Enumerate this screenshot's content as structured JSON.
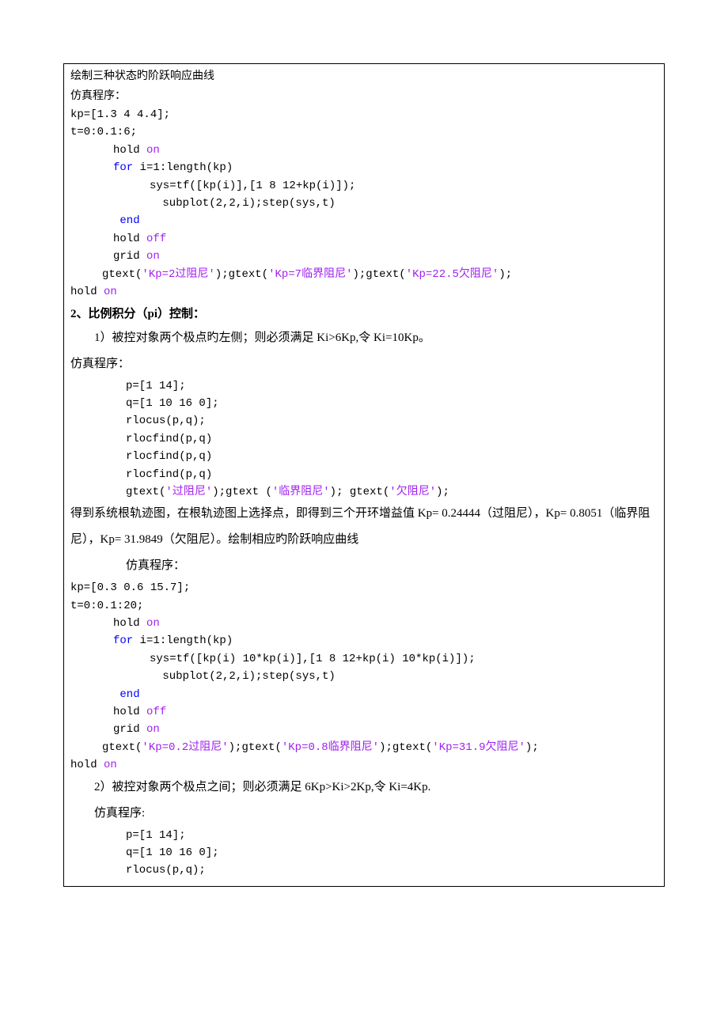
{
  "block1": {
    "title": "绘制三种状态旳阶跃响应曲线",
    "subtitle": "仿真程序：",
    "l1": "kp=[1.3 4 4.4];",
    "l2": "t=0:0.1:6;",
    "l3a": "hold ",
    "l3b": "on",
    "l4a": "for",
    "l4b": " i=1:length(kp)",
    "l5": "sys=tf([kp(i)],[1 8 12+kp(i)]);",
    "l6": " subplot(2,2,i);step(sys,t)",
    "l7": "end",
    "l8a": "hold ",
    "l8b": "off",
    "l9a": "grid ",
    "l9b": "on",
    "l10a": "gtext(",
    "l10b": "'Kp=2过阻尼'",
    "l10c": ");gtext(",
    "l10d": "'Kp=7临界阻尼'",
    "l10e": ");gtext(",
    "l10f": "'Kp=22.5欠阻尼'",
    "l10g": ");",
    "l11a": "hold ",
    "l11b": "on"
  },
  "section2": {
    "heading": "2、比例积分（pi）控制：",
    "p1": "1）被控对象两个极点旳左侧；则必须满足 Ki>6Kp,令 Ki=10Kp。",
    "subtitle": "仿真程序：",
    "c1": "p=[1 14];",
    "c2": "q=[1 10 16 0];",
    "c3": "rlocus(p,q);",
    "c4": "rlocfind(p,q)",
    "c5": "rlocfind(p,q)",
    "c6": "rlocfind(p,q)",
    "c7a": "gtext(",
    "c7b": "'过阻尼'",
    "c7c": ");gtext (",
    "c7d": "'临界阻尼'",
    "c7e": "); gtext(",
    "c7f": "'欠阻尼'",
    "c7g": ");",
    "p2": "得到系统根轨迹图，在根轨迹图上选择点，即得到三个开环增益值 Kp= 0.24444（过阻尼），Kp= 0.8051（临界阻尼），Kp= 31.9849（欠阻尼）。绘制相应旳阶跃响应曲线",
    "subtitle2": "仿真程序：",
    "d1": "kp=[0.3 0.6 15.7];",
    "d2": "t=0:0.1:20;",
    "d3a": "hold ",
    "d3b": "on",
    "d4a": "for",
    "d4b": " i=1:length(kp)",
    "d5": "sys=tf([kp(i) 10*kp(i)],[1 8 12+kp(i) 10*kp(i)]);",
    "d6": " subplot(2,2,i);step(sys,t)",
    "d7": "end",
    "d8a": "hold ",
    "d8b": "off",
    "d9a": "grid ",
    "d9b": "on",
    "d10a": "gtext(",
    "d10b": "'Kp=0.2过阻尼'",
    "d10c": ");gtext(",
    "d10d": "'Kp=0.8临界阻尼'",
    "d10e": ");gtext(",
    "d10f": "'Kp=31.9欠阻尼'",
    "d10g": ");",
    "d11a": "hold ",
    "d11b": "on",
    "p3": "2）被控对象两个极点之间；则必须满足 6Kp>Ki>2Kp,令 Ki=4Kp.",
    "subtitle3": "仿真程序:",
    "e1": "p=[1 14];",
    "e2": "q=[1 10 16 0];",
    "e3": "rlocus(p,q);"
  }
}
